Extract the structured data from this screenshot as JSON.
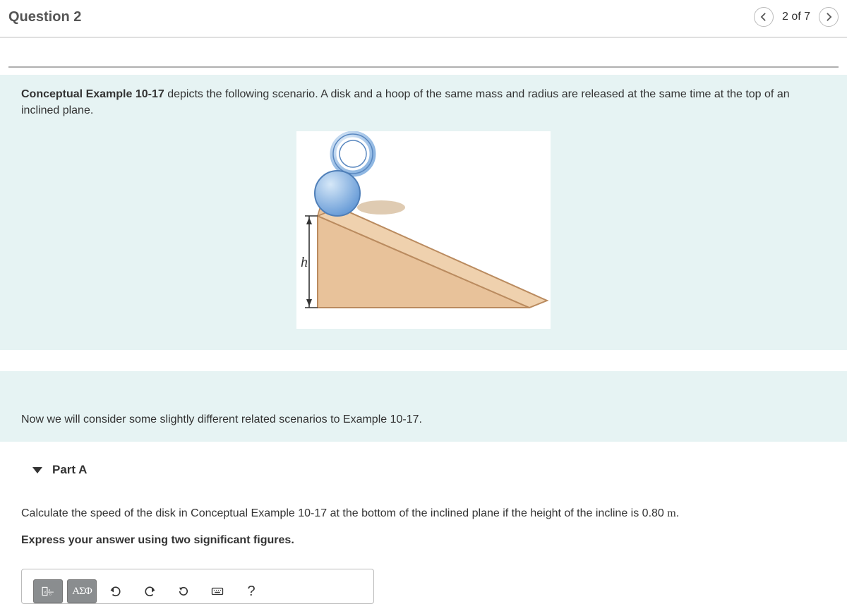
{
  "header": {
    "title": "Question 2",
    "position": "2 of 7"
  },
  "problem": {
    "link": "Conceptual Example 10-17",
    "intro": " depicts the following scenario. A disk and a hoop of the same mass and radius are released at the same time at the top of an inclined plane.",
    "height_label": "h"
  },
  "transition": "Now we will consider some slightly different related scenarios to Example 10-17.",
  "part": {
    "label": "Part A",
    "prompt_pre": "Calculate the speed of the disk in Conceptual Example 10-17 at the bottom of the inclined plane if the height of the incline is 0.80 ",
    "prompt_unit": "m",
    "prompt_post": ".",
    "instruction": "Express your answer using two significant figures."
  },
  "toolbar": {
    "templates": "x√",
    "symbols": "ΑΣΦ",
    "help": "?"
  }
}
